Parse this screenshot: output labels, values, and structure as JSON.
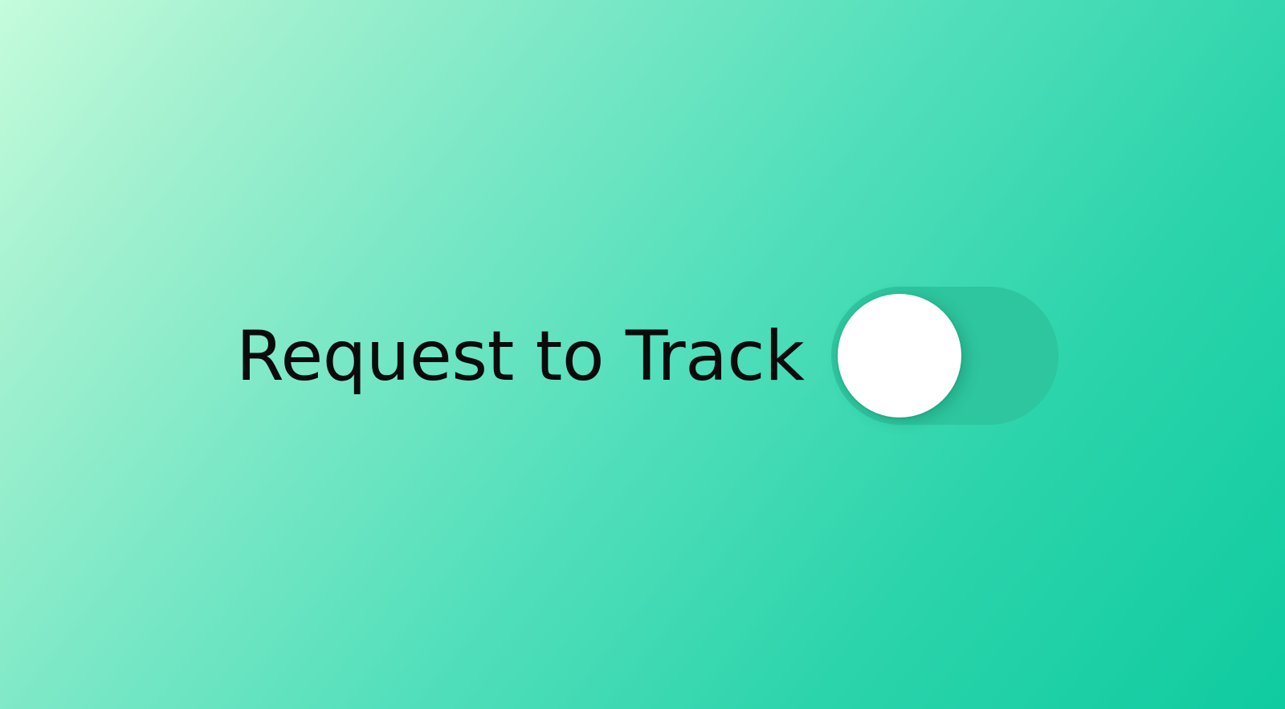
{
  "setting": {
    "label": "Request to Track",
    "toggle_state": "off"
  },
  "colors": {
    "background_light": "#c4fcdc",
    "background_dark": "#10cba0",
    "toggle_track": "#2ec69f",
    "toggle_knob": "#ffffff",
    "label_text": "#0b0b0b"
  }
}
